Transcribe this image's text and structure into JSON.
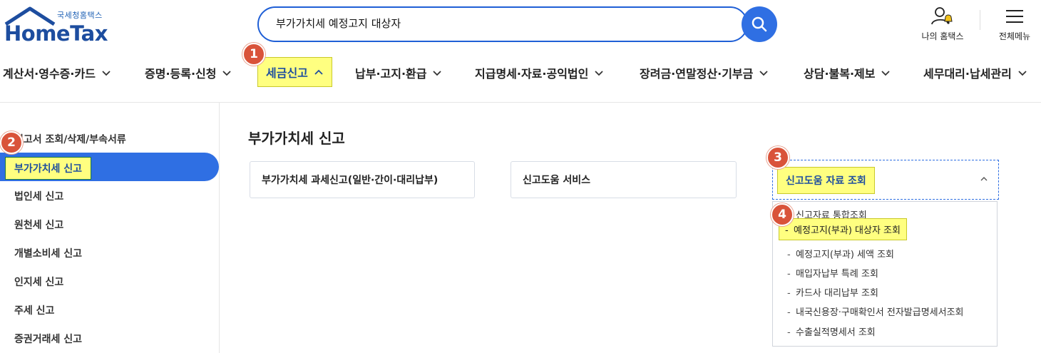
{
  "header": {
    "logo_sub": "국세청홈택스",
    "logo_main": "HomeTax",
    "search_value": "부가가치세 예정고지 대상자",
    "search_icon": "search-icon",
    "my_hometax": "나의 홈택스",
    "all_menu": "전체메뉴"
  },
  "nav": {
    "items": [
      {
        "label": "계산서·영수증·카드"
      },
      {
        "label": "증명·등록·신청"
      },
      {
        "label": "세금신고"
      },
      {
        "label": "납부·고지·환급"
      },
      {
        "label": "지급명세·자료·공익법인"
      },
      {
        "label": "장려금·연말정산·기부금"
      },
      {
        "label": "상담·불복·제보"
      },
      {
        "label": "세무대리·납세관리"
      }
    ],
    "active_index": 2
  },
  "steps": [
    "1",
    "2",
    "3",
    "4"
  ],
  "sidebar": {
    "items": [
      {
        "label": "신고서 조회/삭제/부속서류"
      },
      {
        "label": "부가가치세 신고"
      },
      {
        "label": "법인세 신고"
      },
      {
        "label": "원천세 신고"
      },
      {
        "label": "개별소비세 신고"
      },
      {
        "label": "인지세 신고"
      },
      {
        "label": "주세 신고"
      },
      {
        "label": "증권거래세 신고"
      }
    ],
    "active_index": 1
  },
  "main": {
    "title": "부가가치세 신고",
    "cards": [
      {
        "label": "부가가치세 과세신고(일반·간이·대리납부)"
      },
      {
        "label": "신고도움 서비스"
      }
    ],
    "dropdown": {
      "label": "신고도움 자료 조회",
      "items": [
        {
          "label": "신고자료 통합조회"
        },
        {
          "label": "예정고지(부과) 대상자 조회"
        },
        {
          "label": "예정고지(부과) 세액 조회"
        },
        {
          "label": "매입자납부 특례 조회"
        },
        {
          "label": "카드사 대리납부 조회"
        },
        {
          "label": "내국신용장·구매확인서 전자발급명세서조회"
        },
        {
          "label": "수출실적명세서 조회"
        }
      ],
      "highlight_index": 1
    }
  },
  "colors": {
    "brand_blue": "#1d4d9f",
    "accent_blue": "#2f6fe3",
    "highlight_yellow": "#ffff80",
    "step_badge": "#d9533a"
  }
}
